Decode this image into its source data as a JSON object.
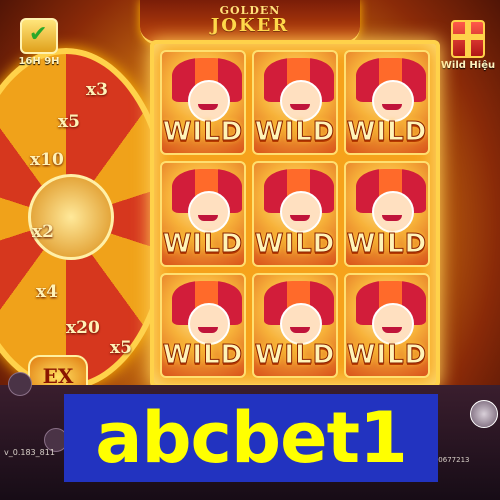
{
  "game": {
    "title_top": "GOLDEN",
    "title_main": "JOKER"
  },
  "left_badge": {
    "icon": "checkmark-icon",
    "label": "16H 9H"
  },
  "right_badge": {
    "icon": "gift-icon",
    "label": "Wild Hiệu"
  },
  "wheel": {
    "multipliers": [
      "x3",
      "x5",
      "x10",
      "x2",
      "x4",
      "x20",
      "x5"
    ]
  },
  "reels": {
    "cells": [
      {
        "symbol": "WILD"
      },
      {
        "symbol": "WILD"
      },
      {
        "symbol": "WILD"
      },
      {
        "symbol": "WILD"
      },
      {
        "symbol": "WILD"
      },
      {
        "symbol": "WILD"
      },
      {
        "symbol": "WILD"
      },
      {
        "symbol": "WILD"
      },
      {
        "symbol": "WILD"
      }
    ]
  },
  "ex_badge": {
    "label": "EX"
  },
  "footer": {
    "left_text": "v_0.183_811",
    "right_text": "Tomorro 14760533.0677213"
  },
  "brand": {
    "text": "abcbet1",
    "background": "#2233c0",
    "color": "#ffff00"
  }
}
